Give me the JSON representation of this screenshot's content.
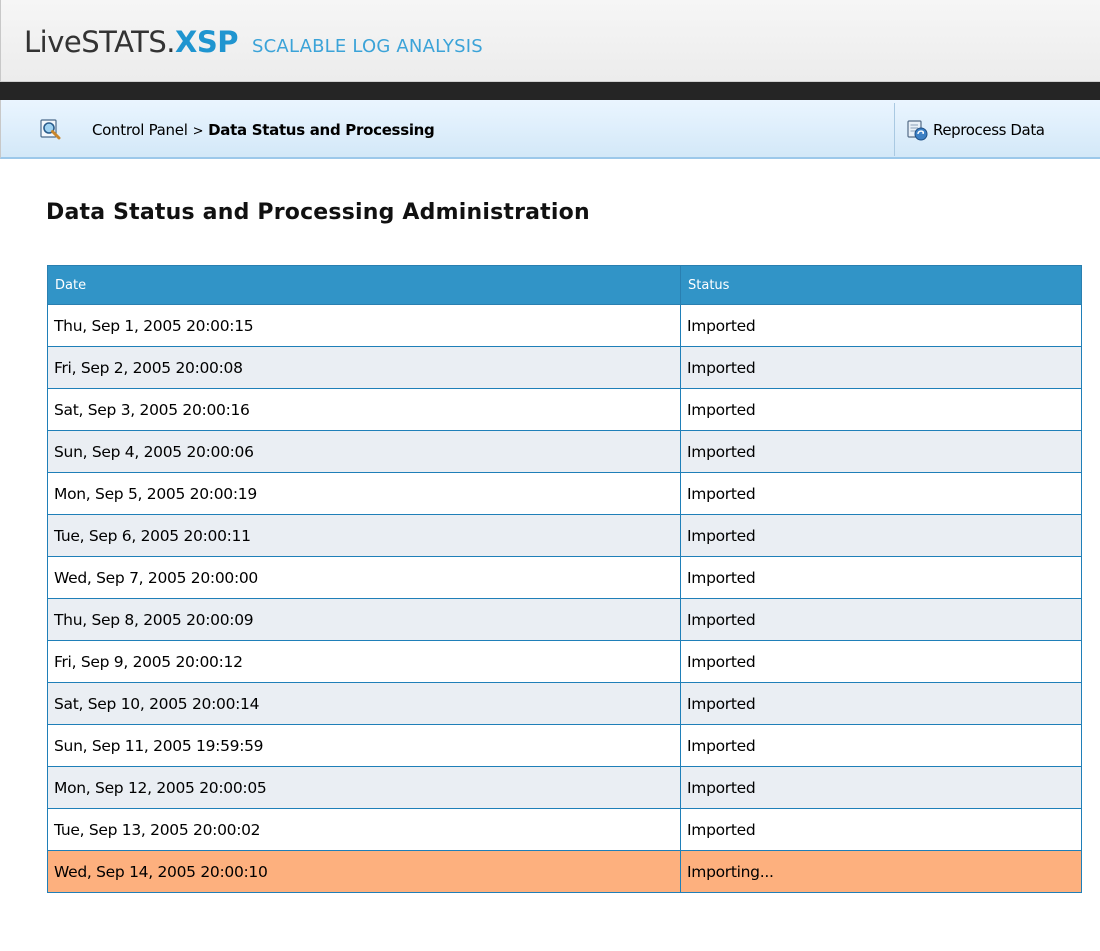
{
  "header": {
    "logo_main": "LiveSTATS.",
    "logo_highlight": "XSP",
    "tagline": "SCALABLE LOG ANALYSIS"
  },
  "breadcrumb": {
    "icon": "magnifier-icon",
    "root": "Control Panel",
    "separator": ">",
    "current": "Data Status and Processing"
  },
  "toolbar": {
    "reprocess_icon": "reprocess-icon",
    "reprocess_label": "Reprocess Data"
  },
  "page": {
    "title": "Data Status and Processing Administration"
  },
  "table": {
    "columns": [
      "Date",
      "Status"
    ],
    "rows": [
      {
        "date": "Thu, Sep 1, 2005 20:00:15",
        "status": "Imported"
      },
      {
        "date": "Fri, Sep 2, 2005 20:00:08",
        "status": "Imported"
      },
      {
        "date": "Sat, Sep 3, 2005 20:00:16",
        "status": "Imported"
      },
      {
        "date": "Sun, Sep 4, 2005 20:00:06",
        "status": "Imported"
      },
      {
        "date": "Mon, Sep 5, 2005 20:00:19",
        "status": "Imported"
      },
      {
        "date": "Tue, Sep 6, 2005 20:00:11",
        "status": "Imported"
      },
      {
        "date": "Wed, Sep 7, 2005 20:00:00",
        "status": "Imported"
      },
      {
        "date": "Thu, Sep 8, 2005 20:00:09",
        "status": "Imported"
      },
      {
        "date": "Fri, Sep 9, 2005 20:00:12",
        "status": "Imported"
      },
      {
        "date": "Sat, Sep 10, 2005 20:00:14",
        "status": "Imported"
      },
      {
        "date": "Sun, Sep 11, 2005 19:59:59",
        "status": "Imported"
      },
      {
        "date": "Mon, Sep 12, 2005 20:00:05",
        "status": "Imported"
      },
      {
        "date": "Tue, Sep 13, 2005 20:00:02",
        "status": "Imported"
      },
      {
        "date": "Wed, Sep 14, 2005 20:00:10",
        "status": "Importing..."
      }
    ]
  },
  "colors": {
    "brand_blue": "#1f95d0",
    "table_header": "#3194c7",
    "row_alt": "#eaeef3",
    "row_active": "#fdb07e"
  }
}
